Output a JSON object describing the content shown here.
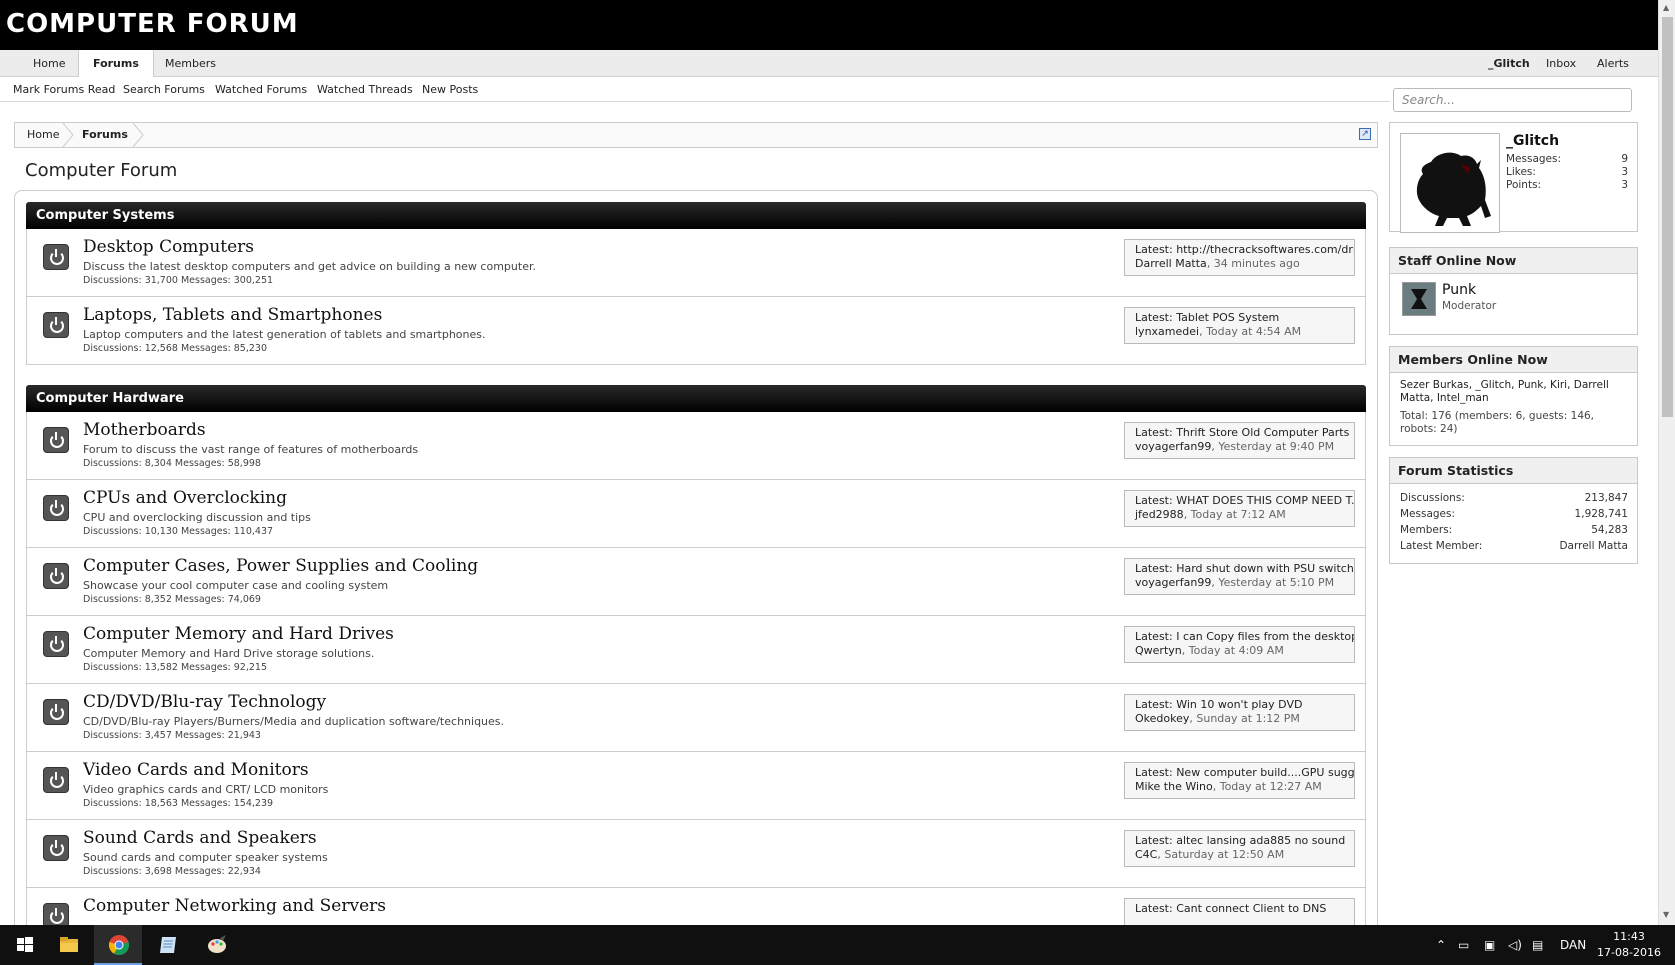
{
  "header": {
    "logo": "COMPUTER FORUM"
  },
  "nav": {
    "tabs": [
      {
        "label": "Home"
      },
      {
        "label": "Forums"
      },
      {
        "label": "Members"
      }
    ],
    "right": {
      "user": "_Glitch",
      "inbox": "Inbox",
      "alerts": "Alerts"
    },
    "subtabs": [
      {
        "label": "Mark Forums Read"
      },
      {
        "label": "Search Forums"
      },
      {
        "label": "Watched Forums"
      },
      {
        "label": "Watched Threads"
      },
      {
        "label": "New Posts"
      }
    ]
  },
  "breadcrumb": {
    "home": "Home",
    "forums": "Forums"
  },
  "page_title": "Computer Forum",
  "categories": [
    {
      "title": "Computer Systems",
      "forums": [
        {
          "title": "Desktop Computers",
          "desc": "Discuss the latest desktop computers and get advice on building a new computer.",
          "stats": "Discussions: 31,700 Messages: 300,251",
          "latest_prefix": "Latest:",
          "latest_title": "http://thecracksoftwares.com/dri...",
          "latest_user": "Darrell Matta",
          "latest_time": ", 34 minutes ago"
        },
        {
          "title": "Laptops, Tablets and Smartphones",
          "desc": "Laptop computers and the latest generation of tablets and smartphones.",
          "stats": "Discussions: 12,568 Messages: 85,230",
          "latest_prefix": "Latest:",
          "latest_title": "Tablet POS System",
          "latest_user": "lynxamedei",
          "latest_time": ", Today at 4:54 AM"
        }
      ]
    },
    {
      "title": "Computer Hardware",
      "forums": [
        {
          "title": "Motherboards",
          "desc": "Forum to discuss the vast range of features of motherboards",
          "stats": "Discussions: 8,304 Messages: 58,998",
          "latest_prefix": "Latest:",
          "latest_title": "Thrift Store Old Computer Parts ...",
          "latest_user": "voyagerfan99",
          "latest_time": ", Yesterday at 9:40 PM"
        },
        {
          "title": "CPUs and Overclocking",
          "desc": "CPU and overclocking discussion and tips",
          "stats": "Discussions: 10,130 Messages: 110,437",
          "latest_prefix": "Latest:",
          "latest_title": "WHAT DOES THIS COMP NEED T...",
          "latest_user": "jfed2988",
          "latest_time": ", Today at 7:12 AM"
        },
        {
          "title": "Computer Cases, Power Supplies and Cooling",
          "desc": "Showcase your cool computer case and cooling system",
          "stats": "Discussions: 8,352 Messages: 74,069",
          "latest_prefix": "Latest:",
          "latest_title": "Hard shut down with PSU switch. ...",
          "latest_user": "voyagerfan99",
          "latest_time": ", Yesterday at 5:10 PM"
        },
        {
          "title": "Computer Memory and Hard Drives",
          "desc": "Computer Memory and Hard Drive storage solutions.",
          "stats": "Discussions: 13,582 Messages: 92,215",
          "latest_prefix": "Latest:",
          "latest_title": "I can Copy files from the desktop...",
          "latest_user": "Qwertyn",
          "latest_time": ", Today at 4:09 AM"
        },
        {
          "title": "CD/DVD/Blu-ray Technology",
          "desc": "CD/DVD/Blu-ray Players/Burners/Media and duplication software/techniques.",
          "stats": "Discussions: 3,457 Messages: 21,943",
          "latest_prefix": "Latest:",
          "latest_title": "Win 10 won't play DVD",
          "latest_user": "Okedokey",
          "latest_time": ", Sunday at 1:12 PM"
        },
        {
          "title": "Video Cards and Monitors",
          "desc": "Video graphics cards and CRT/ LCD monitors",
          "stats": "Discussions: 18,563 Messages: 154,239",
          "latest_prefix": "Latest:",
          "latest_title": "New computer build....GPU sugges...",
          "latest_user": "Mike the Wino",
          "latest_time": ", Today at 12:27 AM"
        },
        {
          "title": "Sound Cards and Speakers",
          "desc": "Sound cards and computer speaker systems",
          "stats": "Discussions: 3,698 Messages: 22,934",
          "latest_prefix": "Latest:",
          "latest_title": "altec lansing ada885 no sound",
          "latest_user": "C4C",
          "latest_time": ", Saturday at 12:50 AM"
        },
        {
          "title": "Computer Networking and Servers",
          "desc": "",
          "stats": "",
          "latest_prefix": "Latest:",
          "latest_title": "Cant connect Client to DNS",
          "latest_user": "",
          "latest_time": ""
        }
      ]
    }
  ],
  "sidebar": {
    "search_placeholder": "Search...",
    "user": {
      "name": "_Glitch",
      "stats": [
        {
          "label": "Messages:",
          "value": "9"
        },
        {
          "label": "Likes:",
          "value": "3"
        },
        {
          "label": "Points:",
          "value": "3"
        }
      ]
    },
    "staff": {
      "title": "Staff Online Now",
      "name": "Punk",
      "role": "Moderator"
    },
    "members": {
      "title": "Members Online Now",
      "list": "Sezer Burkas, _Glitch, Punk, Kiri, Darrell Matta, Intel_man",
      "total": "Total: 176 (members: 6, guests: 146, robots: 24)"
    },
    "stats": {
      "title": "Forum Statistics",
      "rows": [
        {
          "label": "Discussions:",
          "value": "213,847"
        },
        {
          "label": "Messages:",
          "value": "1,928,741"
        },
        {
          "label": "Members:",
          "value": "54,283"
        },
        {
          "label": "Latest Member:",
          "value": "Darrell Matta"
        }
      ]
    }
  },
  "taskbar": {
    "lang": "DAN",
    "time": "11:43",
    "date": "17-08-2016"
  }
}
